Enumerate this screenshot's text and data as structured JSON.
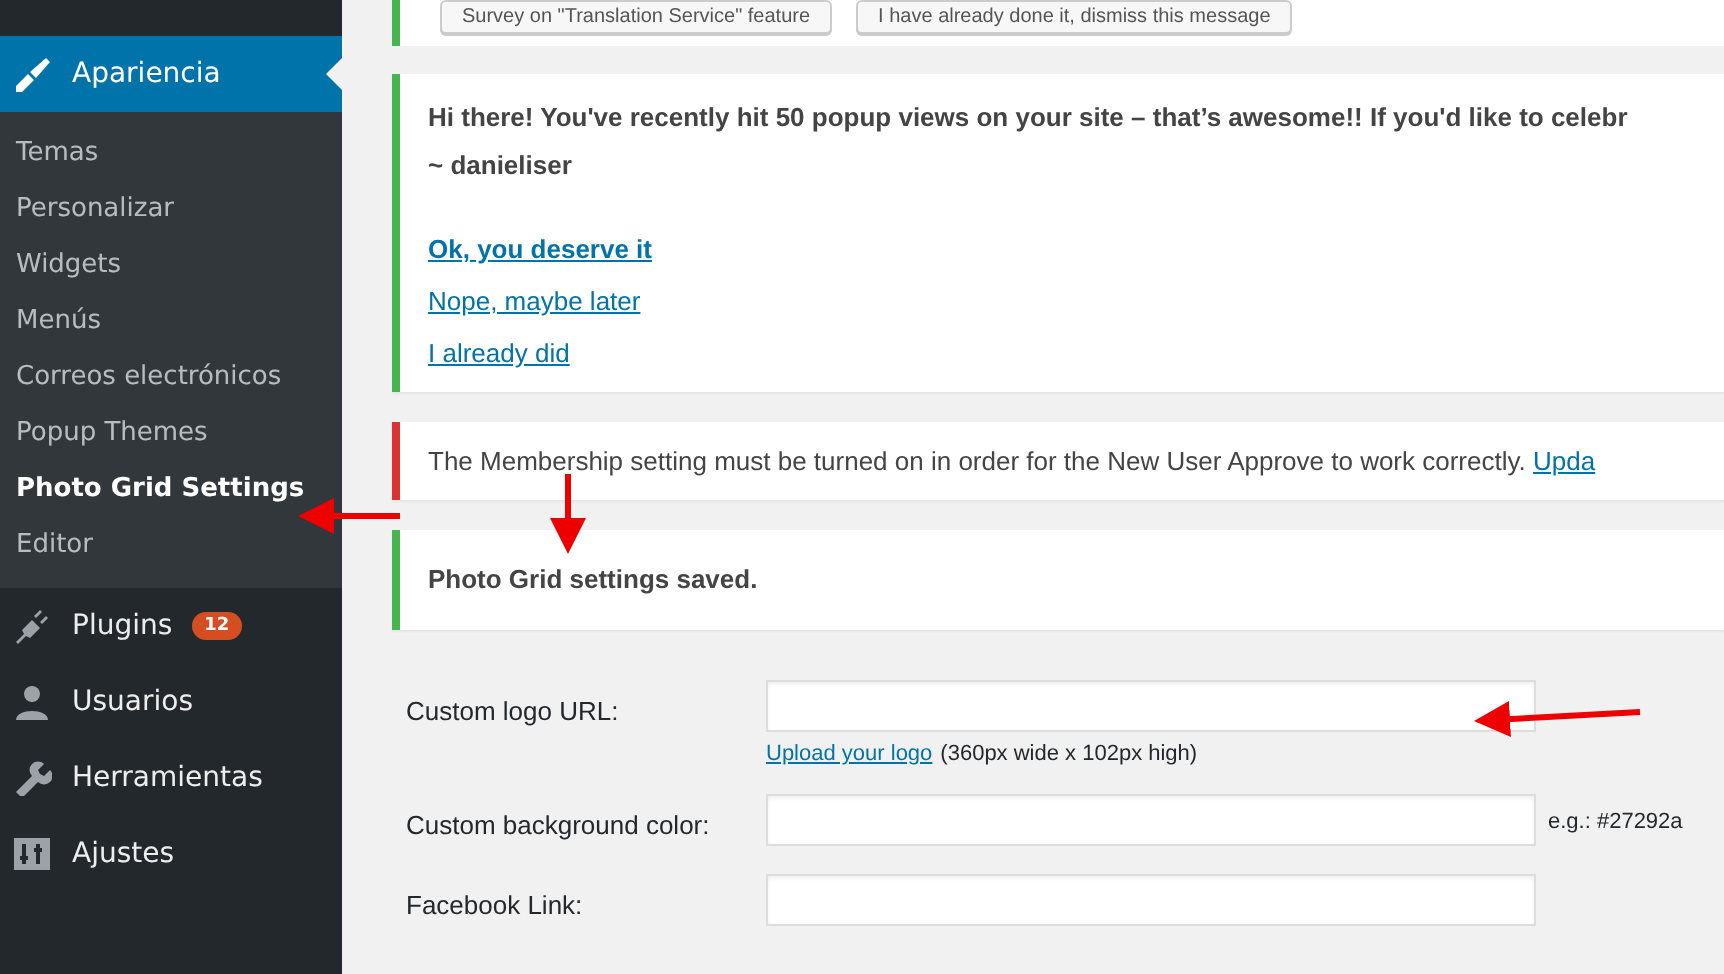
{
  "sidebar": {
    "menu": [
      {
        "label": "Apariencia",
        "selected": true,
        "children": [
          {
            "label": "Temas",
            "selected": false
          },
          {
            "label": "Personalizar",
            "selected": false
          },
          {
            "label": "Widgets",
            "selected": false
          },
          {
            "label": "Menús",
            "selected": false
          },
          {
            "label": "Correos electrónicos",
            "selected": false
          },
          {
            "label": "Popup Themes",
            "selected": false
          },
          {
            "label": "Photo Grid Settings",
            "selected": true
          },
          {
            "label": "Editor",
            "selected": false
          }
        ]
      },
      {
        "label": "Plugins",
        "selected": false,
        "badge": "12"
      },
      {
        "label": "Usuarios",
        "selected": false
      },
      {
        "label": "Herramientas",
        "selected": false
      },
      {
        "label": "Ajustes",
        "selected": false
      }
    ]
  },
  "top_buttons": [
    "Survey on \"Translation Service\" feature",
    "I have already done it, dismiss this message"
  ],
  "notices": [
    {
      "kind": "review",
      "color": "#46b450",
      "message": "Hi there! You've recently hit 50 popup views on your site – that’s awesome!! If you'd like to celebr",
      "signature": "~ danieliser",
      "links": [
        {
          "label": "Ok, you deserve it",
          "bold": true
        },
        {
          "label": "Nope, maybe later",
          "bold": false
        },
        {
          "label": "I already did",
          "bold": false
        }
      ]
    },
    {
      "kind": "error",
      "color": "#dc3232",
      "message": "The Membership setting must be turned on in order for the New User Approve to work correctly.",
      "link": "Upda"
    },
    {
      "kind": "success",
      "color": "#46b450",
      "message": "Photo Grid settings saved."
    }
  ],
  "form": {
    "fields": [
      {
        "label": "Custom logo URL:",
        "link": "Upload your logo",
        "hint": "(360px wide x 102px high)"
      },
      {
        "label": "Custom background color:",
        "note": "e.g.: #27292a"
      },
      {
        "label": "Facebook Link:"
      }
    ]
  }
}
